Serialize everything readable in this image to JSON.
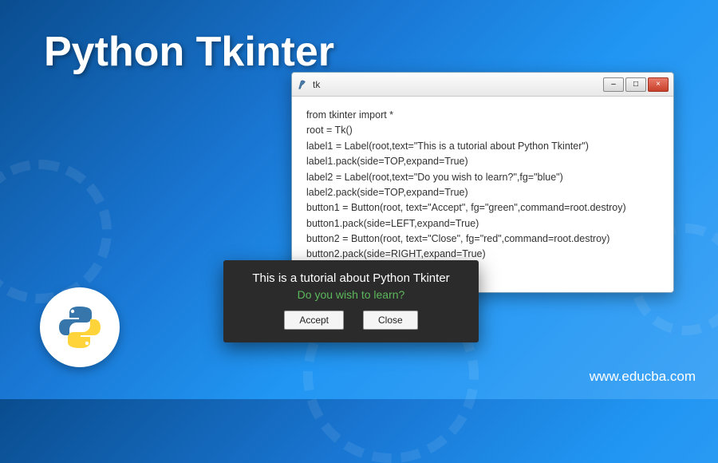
{
  "page_title": "Python Tkinter",
  "site_url": "www.educba.com",
  "logo_name": "python-logo",
  "code_window": {
    "title": "tk",
    "min_label": "–",
    "max_label": "□",
    "close_label": "×",
    "code": "from tkinter import *\nroot = Tk()\nlabel1 = Label(root,text=\"This is a tutorial about Python Tkinter\")\nlabel1.pack(side=TOP,expand=True)\nlabel2 = Label(root,text=\"Do you wish to learn?\",fg=\"blue\")\nlabel2.pack(side=TOP,expand=True)\nbutton1 = Button(root, text=\"Accept\", fg=\"green\",command=root.destroy)\nbutton1.pack(side=LEFT,expand=True)\nbutton2 = Button(root, text=\"Close\", fg=\"red\",command=root.destroy)\nbutton2.pack(side=RIGHT,expand=True)\nroot.mainloop()"
  },
  "dialog": {
    "line1": "This is a tutorial about Python Tkinter",
    "line2": "Do you wish to learn?",
    "accept_label": "Accept",
    "close_label": "Close"
  }
}
